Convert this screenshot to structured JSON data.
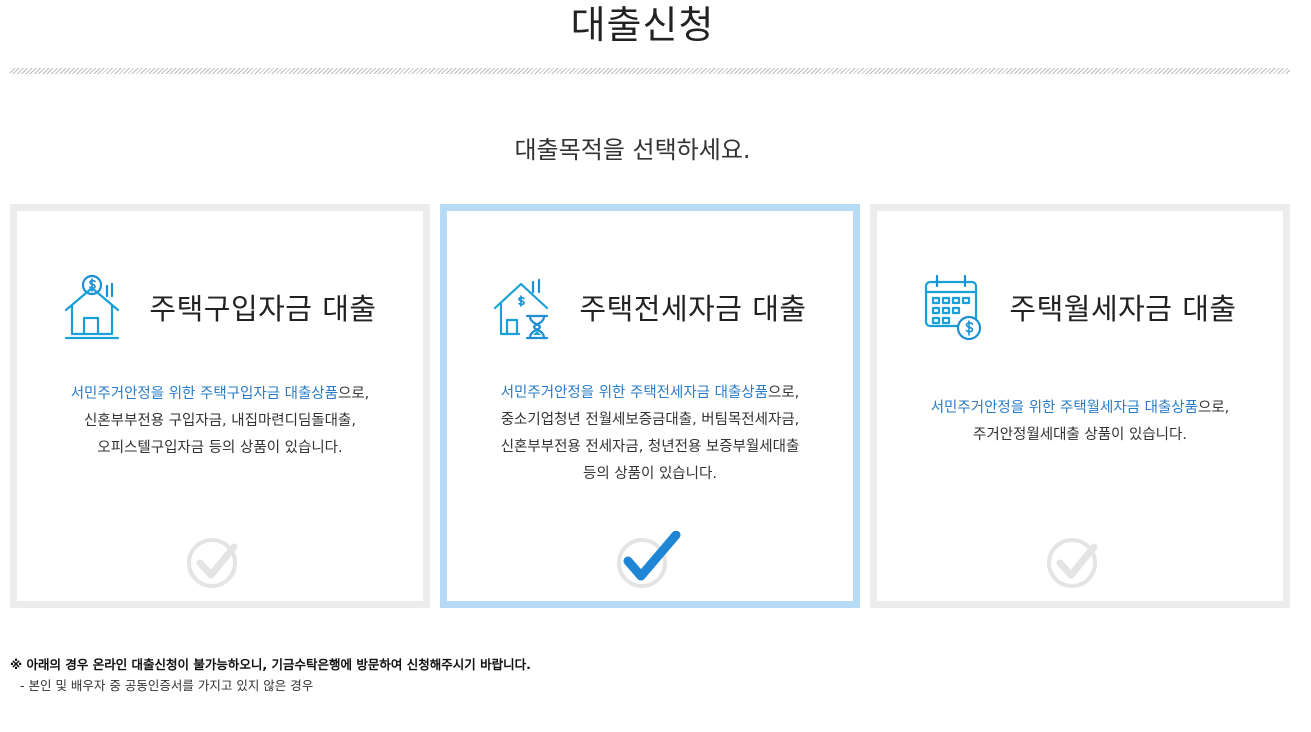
{
  "page": {
    "title": "대출신청",
    "subtitle": "대출목적을 선택하세요."
  },
  "colors": {
    "accent": "#2b7cc8",
    "selected_border": "#b8dbf5",
    "card_border": "#ececec",
    "check_inactive": "#e4e4e4",
    "check_active": "#1f86d6"
  },
  "cards": [
    {
      "title": "주택구입자금 대출",
      "icon": "house-dollar-icon",
      "selected": false,
      "highlight": "서민주거안정을 위한 주택구입자금 대출상품",
      "suffix": "으로,",
      "lines": [
        "신혼부부전용 구입자금, 내집마련디딤돌대출,",
        "오피스텔구입자금 등의 상품이 있습니다."
      ]
    },
    {
      "title": "주택전세자금 대출",
      "icon": "house-hourglass-icon",
      "selected": true,
      "highlight": "서민주거안정을 위한 주택전세자금 대출상품",
      "suffix": "으로,",
      "lines": [
        "중소기업청년 전월세보증금대출, 버팀목전세자금,",
        "신혼부부전용 전세자금, 청년전용 보증부월세대출",
        "등의 상품이 있습니다."
      ]
    },
    {
      "title": "주택월세자금 대출",
      "icon": "calendar-dollar-icon",
      "selected": false,
      "highlight": "서민주거안정을 위한 주택월세자금 대출상품",
      "suffix": "으로,",
      "lines": [
        "주거안정월세대출 상품이 있습니다."
      ]
    }
  ],
  "notice": {
    "line1": "※ 아래의 경우 온라인 대출신청이 불가능하오니, 기금수탁은행에 방문하여 신청해주시기 바랍니다.",
    "line2": "- 본인 및 배우자 중 공동인증서를 가지고 있지 않은 경우"
  }
}
